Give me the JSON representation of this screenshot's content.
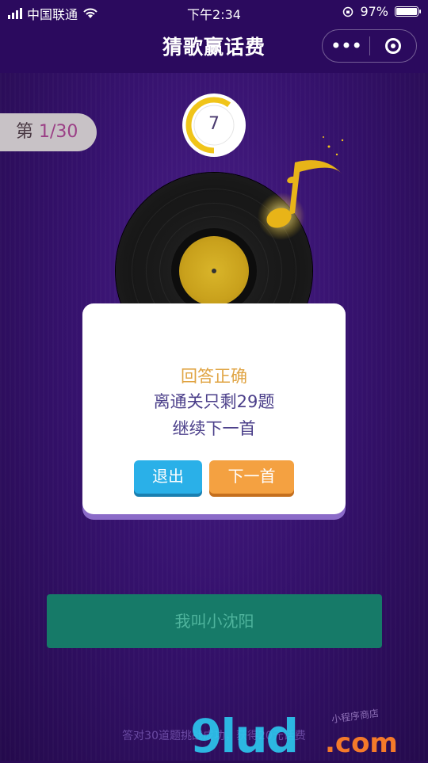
{
  "status_bar": {
    "carrier": "中国联通",
    "time": "下午2:34",
    "battery": "97%"
  },
  "header": {
    "title": "猜歌赢话费",
    "more": "•••"
  },
  "game": {
    "counter_prefix": "第 ",
    "counter_current": "1",
    "counter_total": "/30",
    "timer": "7",
    "timer_progress": 0.6
  },
  "modal": {
    "line1": "回答正确",
    "line2": "离通关只剩29题",
    "line3": "继续下一首",
    "exit_label": "退出",
    "next_label": "下一首"
  },
  "answer_button": "我叫小沈阳",
  "footer_tip": "答对30道题挑战成功，获得20元话费",
  "watermark": {
    "main": "9lud",
    "suffix": ".com",
    "side": "小程序商店"
  },
  "colors": {
    "accent_orange": "#f4a141",
    "accent_blue": "#2ab0e8",
    "answer_green": "#167a68",
    "header_bg": "#2b0a5e"
  }
}
